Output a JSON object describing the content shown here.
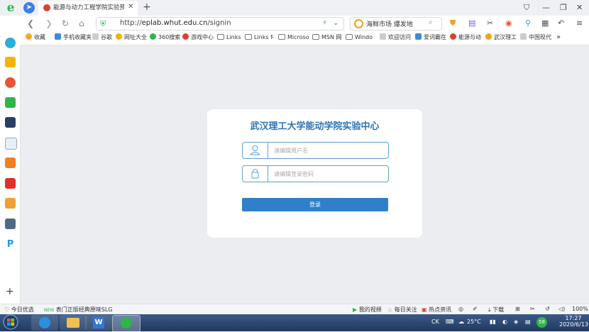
{
  "window": {
    "tab_title": "能源与动力工程学院实验预约平",
    "new_tab_icon": "plus-icon"
  },
  "address_bar": {
    "url_prefix": "http://",
    "url_domain": "eplab.whut.edu.cn",
    "url_path": "/signin",
    "search_text": "海鲜市场 爆发地"
  },
  "bookmarks": [
    {
      "label": "收藏",
      "icon": "star-icon",
      "color": "#f5a623"
    },
    {
      "label": "手机收藏夹",
      "icon": "phone-icon",
      "color": "#3c8bd8"
    },
    {
      "label": "谷歌",
      "icon": "page-icon",
      "color": "#cccccc"
    },
    {
      "label": "网址大全",
      "icon": "globe-icon",
      "color": "#f0b400"
    },
    {
      "label": "360搜索",
      "icon": "search-icon",
      "color": "#2fb54a"
    },
    {
      "label": "游戏中心",
      "icon": "game-icon",
      "color": "#e23b2f"
    },
    {
      "label": "Links",
      "icon": "folder-icon",
      "color": "#777777"
    },
    {
      "label": "Links fo",
      "icon": "folder-icon",
      "color": "#777777"
    },
    {
      "label": "Microso",
      "icon": "folder-icon",
      "color": "#777777"
    },
    {
      "label": "MSN 网",
      "icon": "folder-icon",
      "color": "#777777"
    },
    {
      "label": "Windo",
      "icon": "folder-icon",
      "color": "#777777"
    },
    {
      "label": "欢迎访问",
      "icon": "page-icon",
      "color": "#cccccc"
    },
    {
      "label": "爱词霸在",
      "icon": "dict-icon",
      "color": "#3c8bd8"
    },
    {
      "label": "能源与动",
      "icon": "logo-icon",
      "color": "#d8432f"
    },
    {
      "label": "武汉理工",
      "icon": "logo-icon",
      "color": "#f0a020"
    },
    {
      "label": "中国现代",
      "icon": "page-icon",
      "color": "#cccccc"
    }
  ],
  "bookmarks_more": "»",
  "main": {
    "title": "武汉理工大学能动学院实验中心",
    "username_placeholder": "请编辑用户名",
    "password_placeholder": "请编辑登录密码",
    "login_label": "登录"
  },
  "statusbar": {
    "left1": "今日优选",
    "left2": "表门正版经典原味SLG",
    "left2_badge": "NEW",
    "items": [
      "我的视频",
      "每日关注",
      "热点资讯",
      "下载"
    ],
    "zoom": "100%"
  },
  "taskbar": {
    "lang": "CK",
    "weather": "25°C",
    "time": "17:27",
    "date": "2020/6/13",
    "badge": "58"
  },
  "colors": {
    "accent": "#2f80c8",
    "title": "#2f73b3",
    "field_border": "#5aa1d8"
  }
}
